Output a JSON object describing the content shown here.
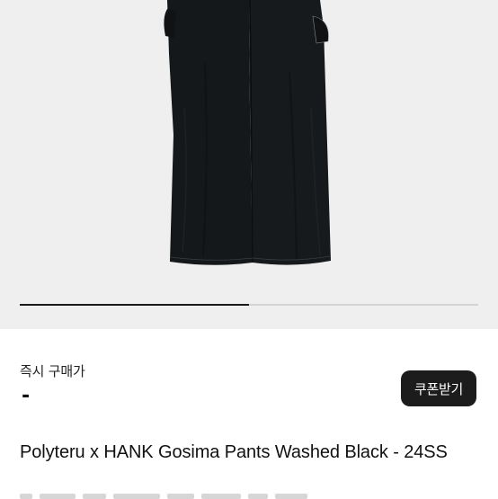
{
  "gallery": {
    "image_subject": "black wide-leg pants",
    "slide_progress": 0.5
  },
  "purchase": {
    "label": "즉시 구매가",
    "price": "-",
    "coupon_label": "쿠폰받기"
  },
  "product": {
    "title": "Polyteru x HANK Gosima Pants Washed Black - 24SS"
  },
  "colors": {
    "button_bg": "#1c1c1c",
    "image_bg": "#efefef",
    "pants": "#15181b"
  }
}
